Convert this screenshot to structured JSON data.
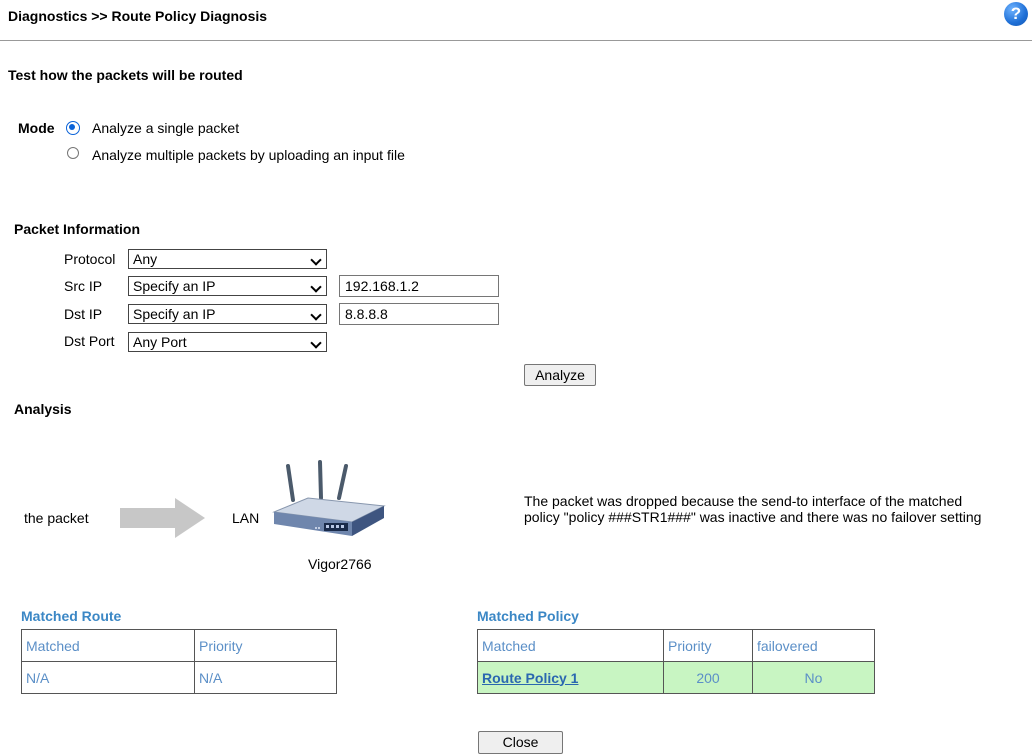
{
  "header": {
    "title": "Diagnostics >> Route Policy Diagnosis",
    "help_glyph": "?"
  },
  "subtitle": "Test how the packets will be routed",
  "mode": {
    "label": "Mode",
    "options": [
      {
        "label": "Analyze a single packet",
        "checked": true
      },
      {
        "label": "Analyze multiple packets by uploading an input file",
        "checked": false
      }
    ]
  },
  "packet_info": {
    "title": "Packet Information",
    "protocol": {
      "label": "Protocol",
      "value": "Any"
    },
    "src_ip": {
      "label": "Src IP",
      "mode": "Specify an IP",
      "value": "192.168.1.2"
    },
    "dst_ip": {
      "label": "Dst IP",
      "mode": "Specify an IP",
      "value": "8.8.8.8"
    },
    "dst_port": {
      "label": "Dst Port",
      "value": "Any Port"
    },
    "analyze_label": "Analyze"
  },
  "analysis": {
    "title": "Analysis",
    "packet_label": "the packet",
    "lan_label": "LAN",
    "device_name": "Vigor2766",
    "message_line1": "The packet was dropped because the send-to interface of the matched",
    "message_line2": "policy \"policy ###STR1###\" was inactive and there was no failover setting"
  },
  "matched_route": {
    "title": "Matched Route",
    "headers": [
      "Matched",
      "Priority"
    ],
    "row": [
      "N/A",
      "N/A"
    ]
  },
  "matched_policy": {
    "title": "Matched Policy",
    "headers": [
      "Matched",
      "Priority",
      "failovered"
    ],
    "row": [
      "Route Policy 1",
      "200",
      "No"
    ]
  },
  "close_label": "Close",
  "colors": {
    "accent": "#3b87c5",
    "highlight_row": "#c8f5c2",
    "radio": "#0b63d8"
  }
}
